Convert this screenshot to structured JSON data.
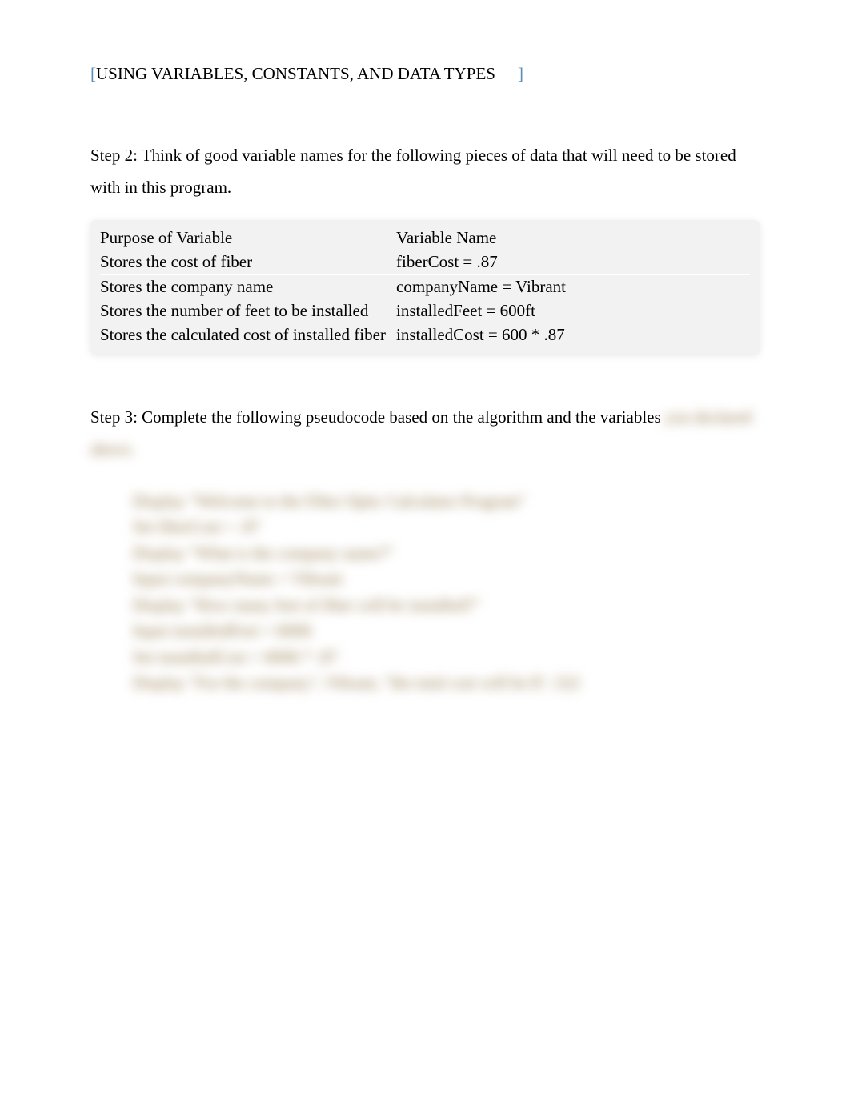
{
  "header": {
    "open_bracket": "[",
    "title": "USING VARIABLES, CONSTANTS, AND DATA TYPES",
    "close_bracket": "]"
  },
  "step2": {
    "text": "Step 2:   Think of good variable names for the following pieces of data that will need to be stored with in this program."
  },
  "table": {
    "header": {
      "purpose": "Purpose of Variable",
      "name": "Variable Name"
    },
    "rows": [
      {
        "purpose": "Stores the cost of fiber",
        "name": "fiberCost = .87"
      },
      {
        "purpose": "Stores the company name",
        "name": "companyName = Vibrant"
      },
      {
        "purpose": "Stores the number of feet to be installed",
        "name": "installedFeet = 600ft"
      },
      {
        "purpose": "Stores the calculated cost of installed fiber",
        "name": "installedCost = 600 * .87"
      }
    ]
  },
  "step3": {
    "visible": "Step 3: Complete the following pseudocode based on the algorithm and the variables",
    "blurred_inline": "you declared above."
  },
  "pseudocode": {
    "lines": [
      "Display \"Welcome to the Fiber Optic Calculator Program\"",
      "Set fiberCost = .87",
      "Display \"What is the company name?\"",
      "Input companyName = Vibrant",
      "Display \"How many feet of fiber will be installed?\"",
      "Input installedFeet = 600ft",
      "Set installedCost = 600ft * .87",
      "Display \"For the company\", Vibrant, \"the total cost will be $\", 522"
    ]
  }
}
